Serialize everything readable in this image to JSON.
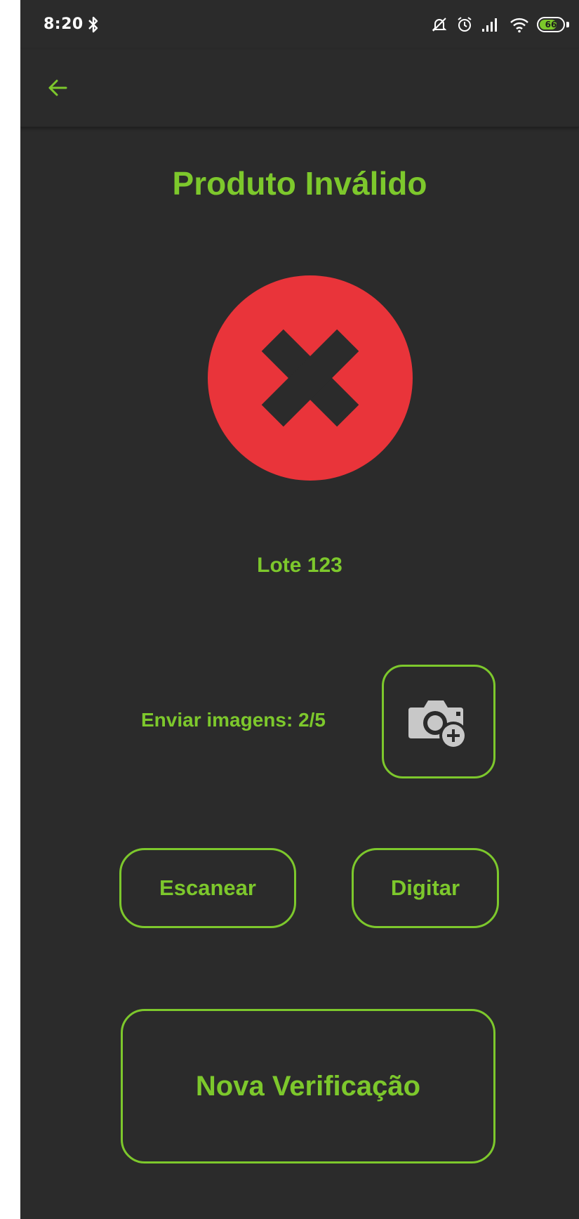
{
  "status_bar": {
    "time": "8:20",
    "battery_level": "66",
    "icons": [
      "bluetooth-icon",
      "mute-icon",
      "alarm-icon",
      "signal-icon",
      "wifi-icon",
      "battery-icon"
    ]
  },
  "app_bar": {
    "back_icon": "arrow-left-icon"
  },
  "main": {
    "title": "Produto Inválido",
    "result_icon": "error-x-circle-icon",
    "lot": "Lote 123",
    "upload_label": "Enviar imagens: 2/5",
    "camera_icon": "add-photo-camera-icon",
    "scan_label": "Escanear",
    "type_label": "Digitar",
    "new_check_label": "Nova Verificação"
  },
  "colors": {
    "background": "#2b2b2b",
    "accent": "#7dc82c",
    "error": "#e9343a",
    "status_text": "#ffffff",
    "icon_gray": "#c8c8c8"
  }
}
